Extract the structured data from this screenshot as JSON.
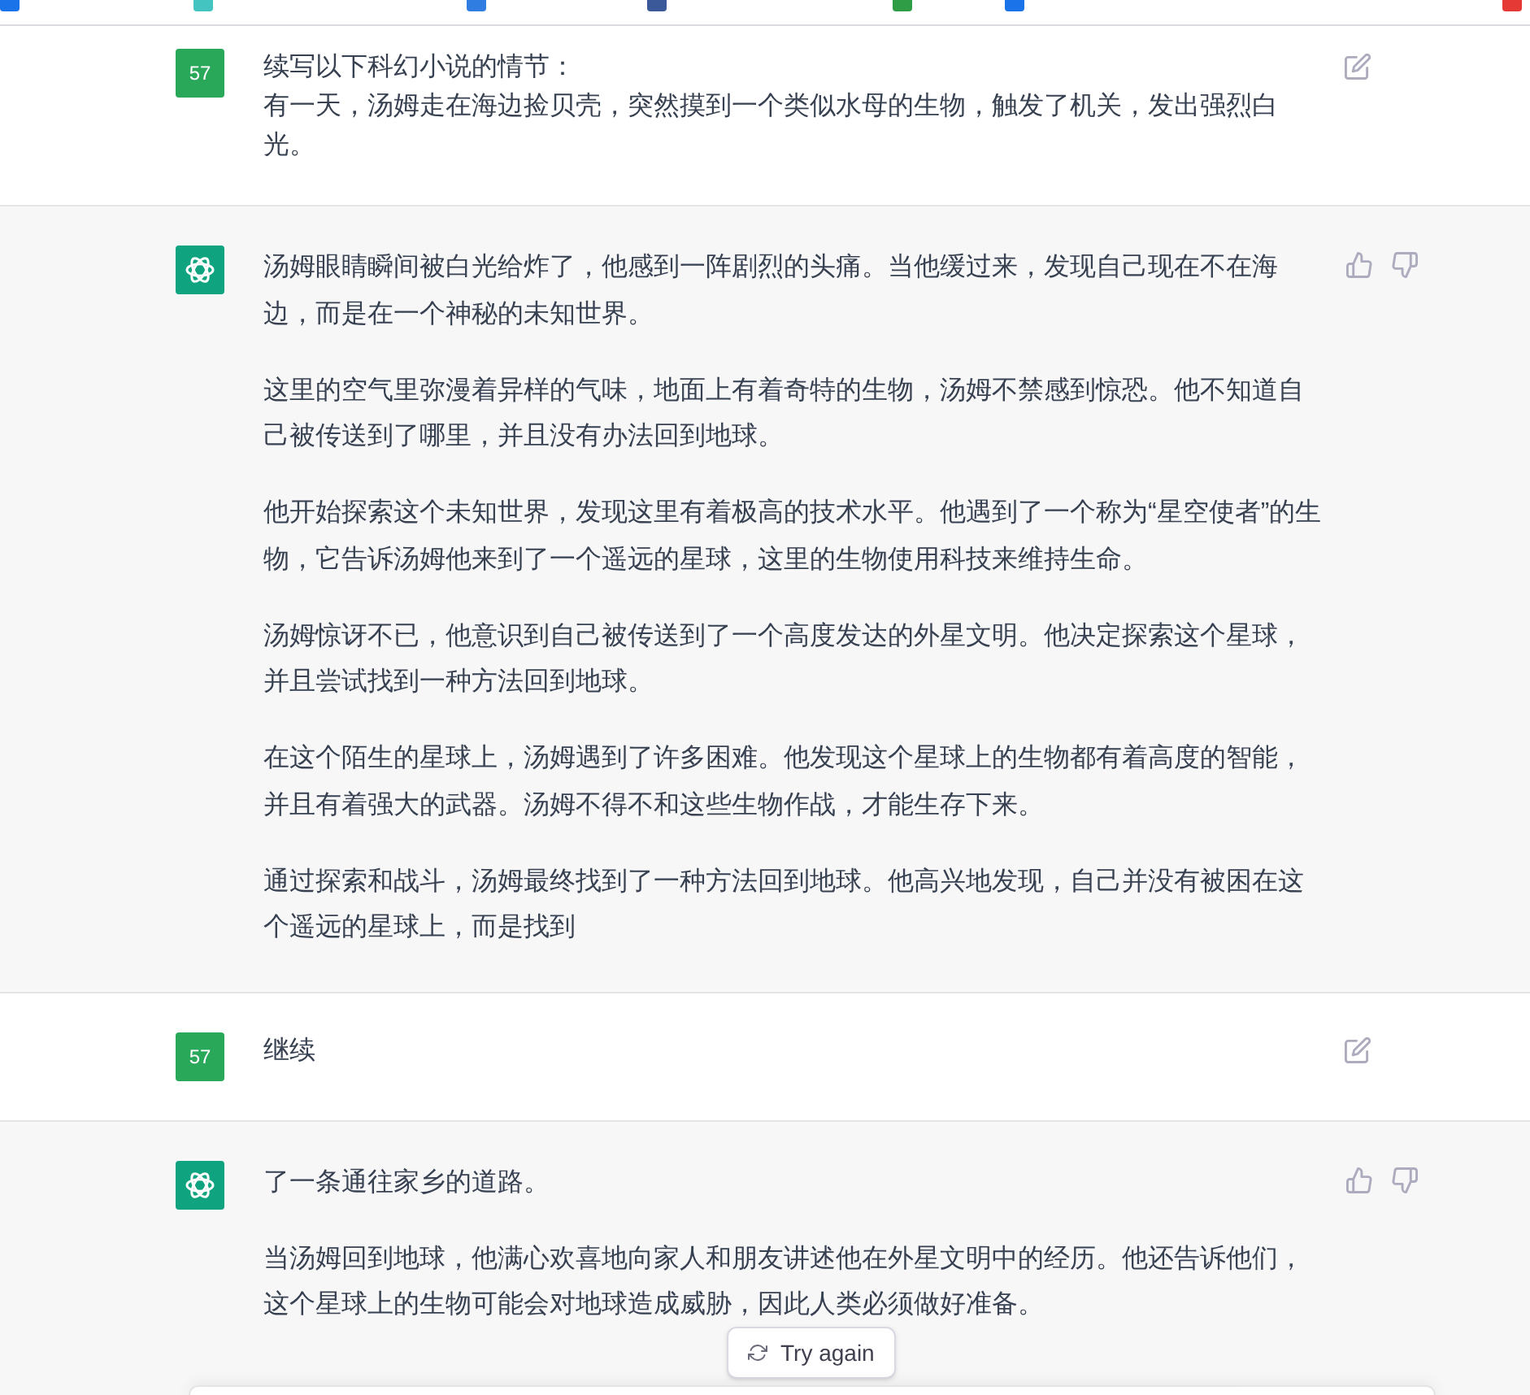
{
  "bookmarks_bar": {
    "items": [
      {
        "color": "#1a73e8"
      },
      {
        "color": "#44c4c0"
      },
      {
        "color": "#2f7de1"
      },
      {
        "color": "#3b5998"
      },
      {
        "color": "#2e9d46"
      },
      {
        "color": "#1a73e8"
      },
      {
        "color": "#e53935"
      }
    ]
  },
  "messages": [
    {
      "kind": "user",
      "avatar": "57",
      "lines": [
        "续写以下科幻小说的情节：",
        "有一天，汤姆走在海边捡贝壳，突然摸到一个类似水母的生物，触发了机关，发出强烈白光。"
      ]
    },
    {
      "kind": "assistant",
      "paragraphs": [
        "汤姆眼睛瞬间被白光给炸了，他感到一阵剧烈的头痛。当他缓过来，发现自己现在不在海边，而是在一个神秘的未知世界。",
        "这里的空气里弥漫着异样的气味，地面上有着奇特的生物，汤姆不禁感到惊恐。他不知道自己被传送到了哪里，并且没有办法回到地球。",
        "他开始探索这个未知世界，发现这里有着极高的技术水平。他遇到了一个称为“星空使者”的生物，它告诉汤姆他来到了一个遥远的星球，这里的生物使用科技来维持生命。",
        "汤姆惊讶不已，他意识到自己被传送到了一个高度发达的外星文明。他决定探索这个星球，并且尝试找到一种方法回到地球。",
        "在这个陌生的星球上，汤姆遇到了许多困难。他发现这个星球上的生物都有着高度的智能，并且有着强大的武器。汤姆不得不和这些生物作战，才能生存下来。",
        "通过探索和战斗，汤姆最终找到了一种方法回到地球。他高兴地发现，自己并没有被困在这个遥远的星球上，而是找到"
      ]
    },
    {
      "kind": "user",
      "avatar": "57",
      "lines": [
        "继续"
      ]
    },
    {
      "kind": "assistant",
      "paragraphs": [
        "了一条通往家乡的道路。",
        "当汤姆回到地球，他满心欢喜地向家人和朋友讲述他在外星文明中的经历。他还告诉他们，这个星球上的生物可能会对地球造成威胁，因此人类必须做好准备。"
      ]
    }
  ],
  "try_again_button": {
    "label": "Try again"
  }
}
